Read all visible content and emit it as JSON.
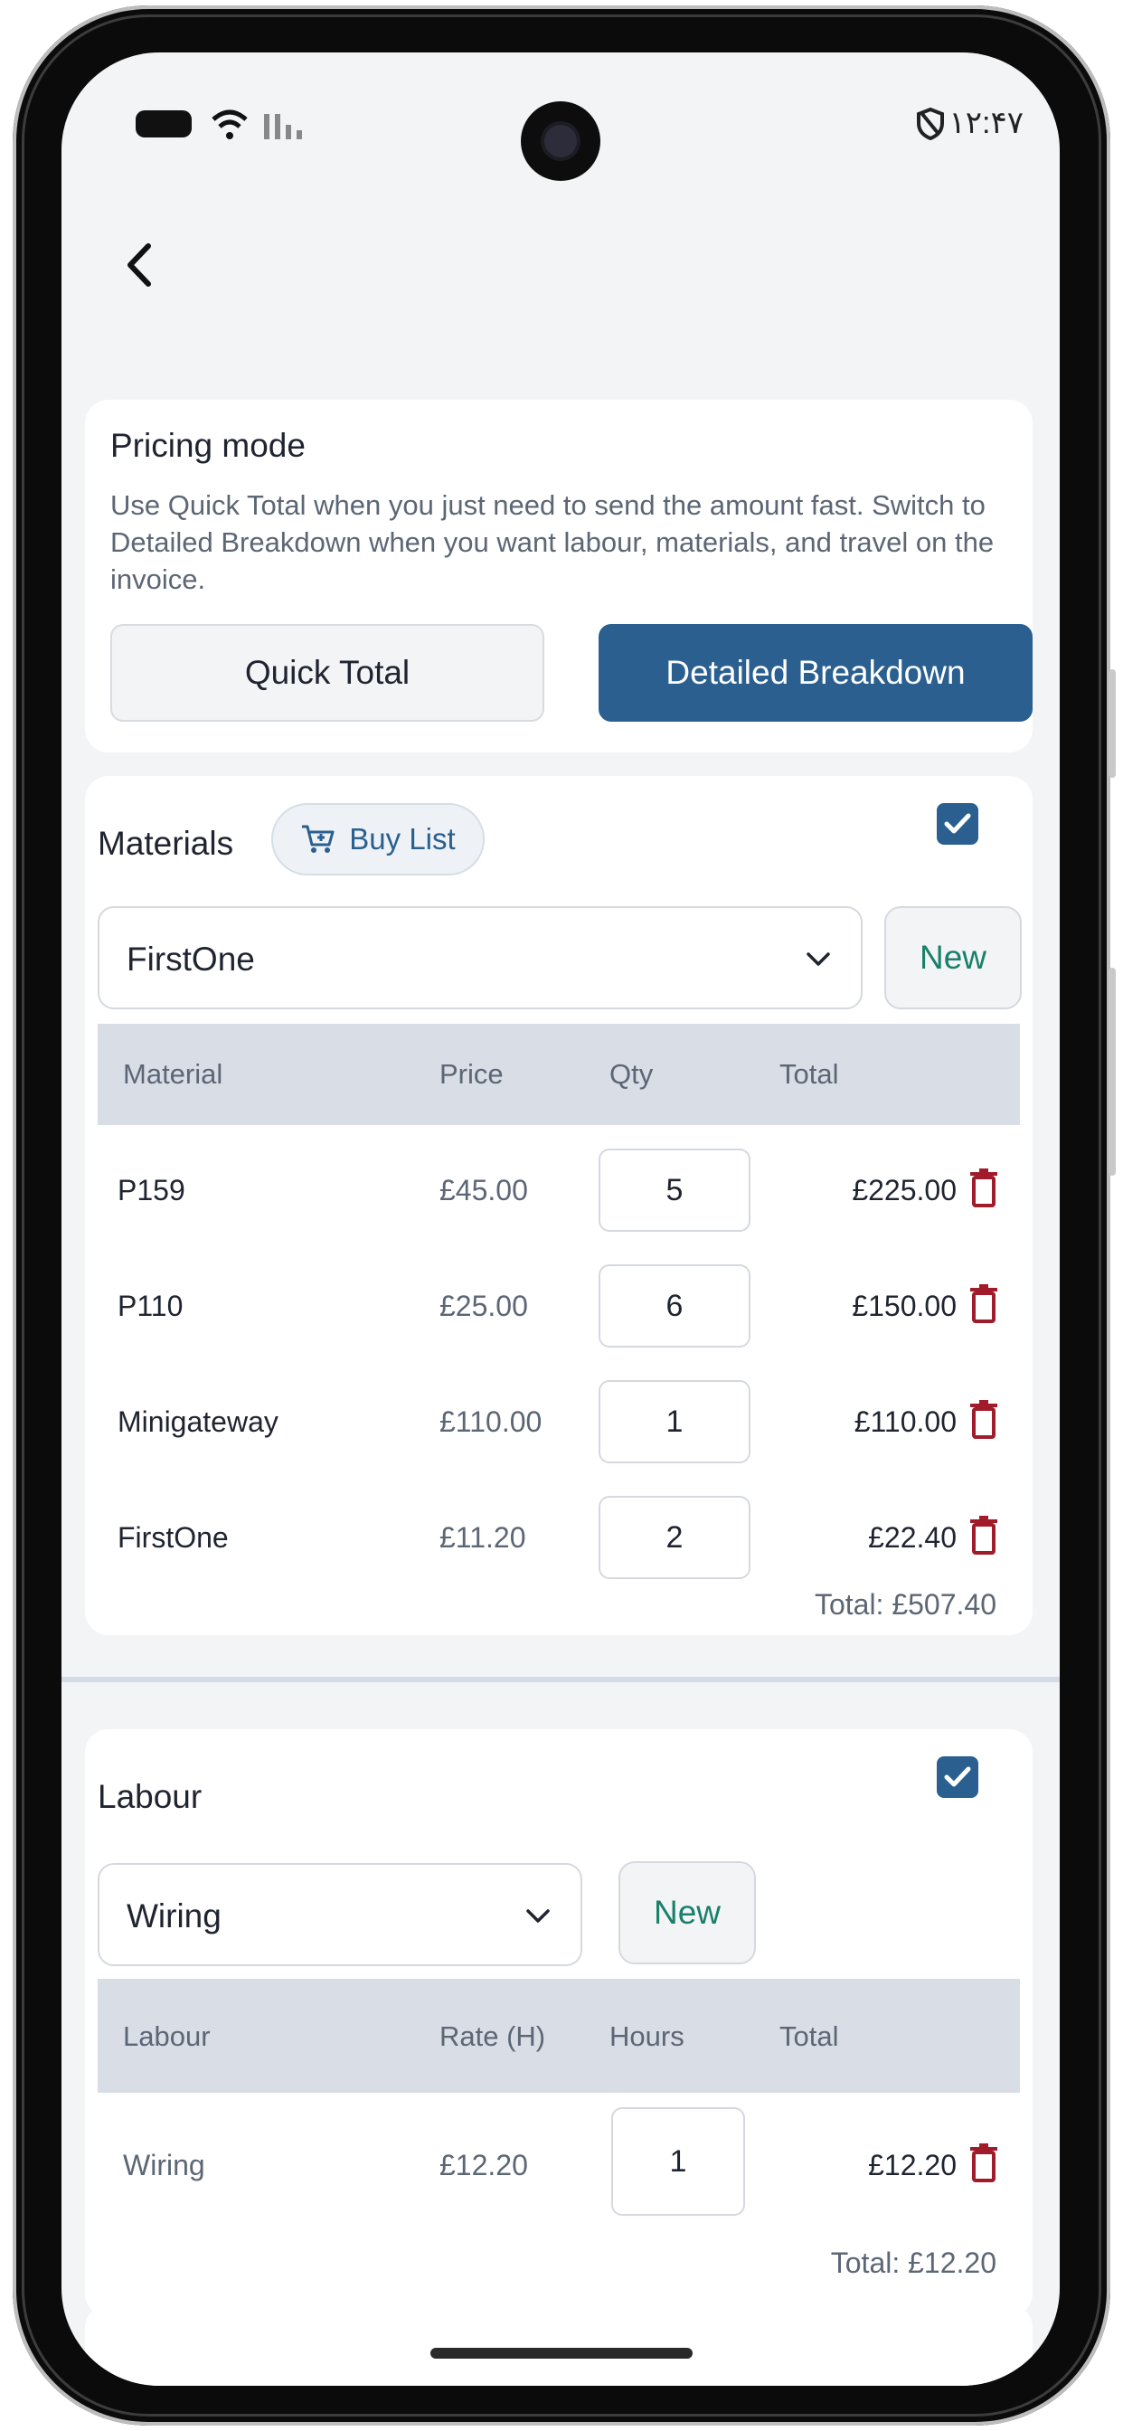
{
  "status_bar": {
    "time": "۱۲:۴۷"
  },
  "pricing": {
    "title": "Pricing mode",
    "description": "Use Quick Total when you just need to send the amount fast. Switch to Detailed Breakdown when you want labour, materials, and travel on the invoice.",
    "options": [
      "Quick Total",
      "Detailed Breakdown"
    ],
    "selected": "Detailed Breakdown"
  },
  "materials": {
    "title": "Materials",
    "buy_list_label": "Buy List",
    "enabled": true,
    "selected_material": "FirstOne",
    "new_label": "New",
    "headers": {
      "material": "Material",
      "price": "Price",
      "qty": "Qty",
      "total": "Total"
    },
    "rows": [
      {
        "name": "P159",
        "price": "£45.00",
        "qty": "5",
        "total": "£225.00"
      },
      {
        "name": "P110",
        "price": "£25.00",
        "qty": "6",
        "total": "£150.00"
      },
      {
        "name": "Minigateway",
        "price": "£110.00",
        "qty": "1",
        "total": "£110.00"
      },
      {
        "name": "FirstOne",
        "price": "£11.20",
        "qty": "2",
        "total": "£22.40"
      }
    ],
    "grand_total": "Total: £507.40"
  },
  "labour": {
    "title": "Labour",
    "enabled": true,
    "selected_labour": "Wiring",
    "new_label": "New",
    "headers": {
      "labour": "Labour",
      "rate": "Rate (H)",
      "hours": "Hours",
      "total": "Total"
    },
    "rows": [
      {
        "name": "Wiring",
        "rate": "£12.20",
        "hours": "1",
        "total": "£12.20"
      }
    ],
    "grand_total": "Total: £12.20"
  },
  "colors": {
    "accent": "#2a5f8f",
    "new_text": "#18806b",
    "delete": "#a01c2a"
  },
  "icons": {
    "back": "chevron-left-icon",
    "cart": "cart-icon",
    "delete": "trash-icon",
    "dropdown": "chevron-down-icon",
    "check": "check-icon"
  }
}
